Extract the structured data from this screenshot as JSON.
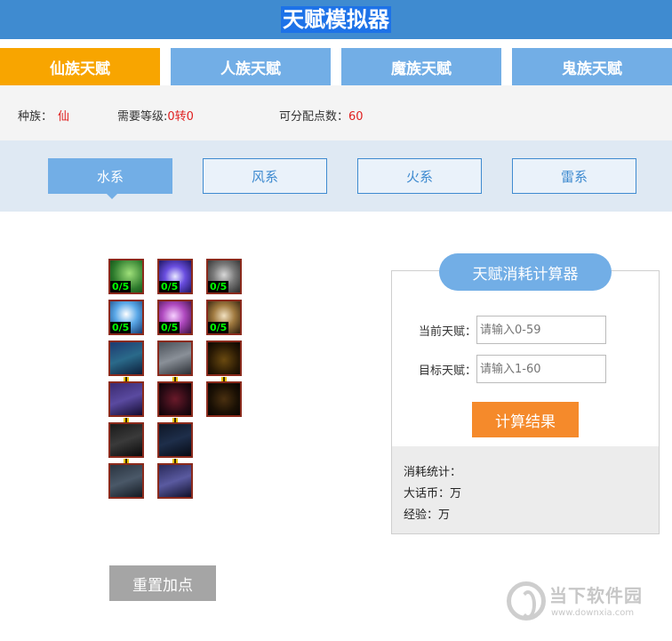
{
  "header": {
    "title": "天赋模拟器"
  },
  "race_tabs": [
    {
      "label": "仙族天赋",
      "active": true
    },
    {
      "label": "人族天赋",
      "active": false
    },
    {
      "label": "魔族天赋",
      "active": false
    },
    {
      "label": "鬼族天赋",
      "active": false
    }
  ],
  "info": {
    "race_label": "种族：",
    "race_value": "仙",
    "level_label": "需要等级:",
    "level_value": "0转0",
    "points_label": "可分配点数：",
    "points_value": "60"
  },
  "element_tabs": [
    {
      "label": "水系",
      "active": true
    },
    {
      "label": "风系",
      "active": false
    },
    {
      "label": "火系",
      "active": false
    },
    {
      "label": "雷系",
      "active": false
    }
  ],
  "talents": [
    {
      "name": "talent-1-1",
      "points": "0/5",
      "color": "#3a9a3a"
    },
    {
      "name": "talent-1-2",
      "points": "0/5",
      "color": "#5a3fd0"
    },
    {
      "name": "talent-1-3",
      "points": "0/5",
      "color": "#6a6a6a"
    },
    {
      "name": "talent-2-1",
      "points": "0/5",
      "color": "#3a86c8"
    },
    {
      "name": "talent-2-2",
      "points": "0/5",
      "color": "#b04ac0"
    },
    {
      "name": "talent-2-3",
      "points": "0/5",
      "color": "#8a6a3a"
    }
  ],
  "calculator": {
    "title": "天赋消耗计算器",
    "current_label": "当前天赋：",
    "current_placeholder": "请输入0-59",
    "target_label": "目标天赋：",
    "target_placeholder": "请输入1-60",
    "button_label": "计算结果",
    "stats_title": "消耗统计：",
    "coin_label": "大话币：万",
    "exp_label": "经验：万"
  },
  "reset_label": "重置加点",
  "watermark": {
    "text": "当下软件园",
    "url": "www.downxia.com"
  }
}
